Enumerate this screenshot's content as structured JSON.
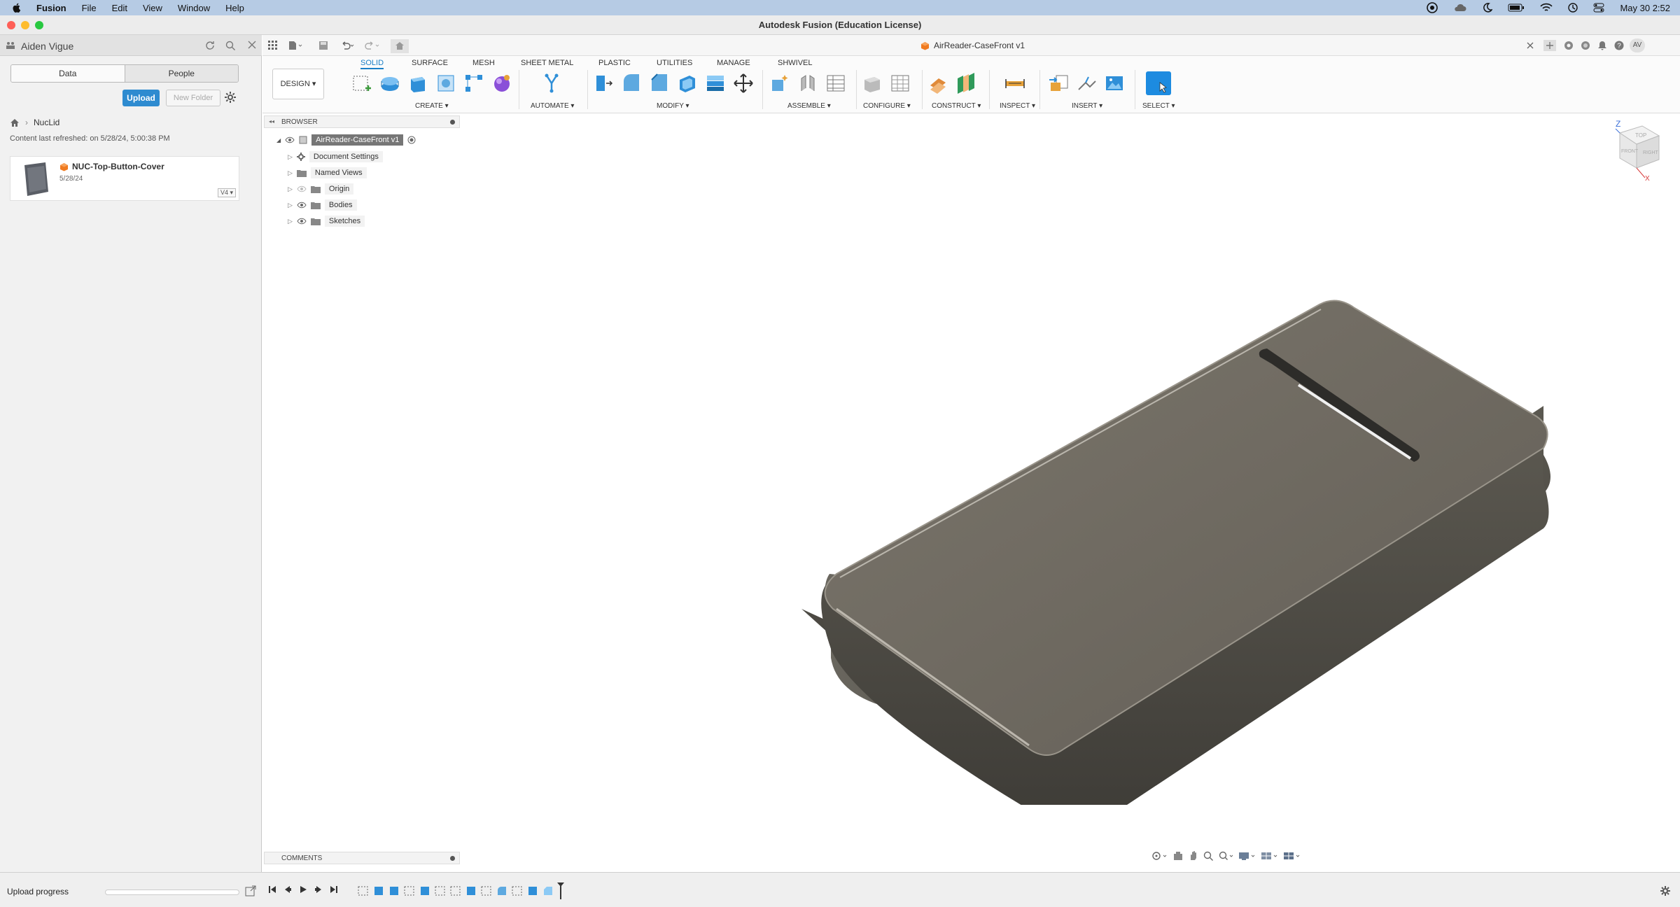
{
  "menubar": {
    "app": "Fusion",
    "items": [
      "File",
      "Edit",
      "View",
      "Window",
      "Help"
    ],
    "clock": "May 30  2:52"
  },
  "window": {
    "title": "Autodesk Fusion (Education License)"
  },
  "data_panel": {
    "user": "Aiden Vigue",
    "tabs": [
      "Data",
      "People"
    ],
    "upload_label": "Upload",
    "new_folder_label": "New Folder",
    "breadcrumb": "NucLid",
    "refreshed": "Content last refreshed: on 5/28/24, 5:00:38 PM",
    "file": {
      "name": "NUC-Top-Button-Cover",
      "date": "5/28/24",
      "version": "V4"
    }
  },
  "document_tab": {
    "name": "AirReader-CaseFront v1"
  },
  "toolbar": {
    "workspace": "DESIGN",
    "tabs": [
      "SOLID",
      "SURFACE",
      "MESH",
      "SHEET METAL",
      "PLASTIC",
      "UTILITIES",
      "MANAGE",
      "SHWIVEL"
    ],
    "groups": [
      "CREATE",
      "AUTOMATE",
      "MODIFY",
      "ASSEMBLE",
      "CONFIGURE",
      "CONSTRUCT",
      "INSPECT",
      "INSERT",
      "SELECT"
    ]
  },
  "browser": {
    "title": "BROWSER",
    "root": "AirReader-CaseFront v1",
    "items": [
      "Document Settings",
      "Named Views",
      "Origin",
      "Bodies",
      "Sketches"
    ]
  },
  "viewcube": {
    "z": "Z",
    "x": "X",
    "face_top": "TOP",
    "face_front": "FRONT",
    "face_right": "RIGHT"
  },
  "comments": {
    "title": "COMMENTS"
  },
  "status": {
    "upload_progress": "Upload progress",
    "user_initials": "AV"
  },
  "colors": {
    "accent": "#1a7fc7",
    "upload": "#2e8bd0",
    "body": "#6e6a62"
  }
}
